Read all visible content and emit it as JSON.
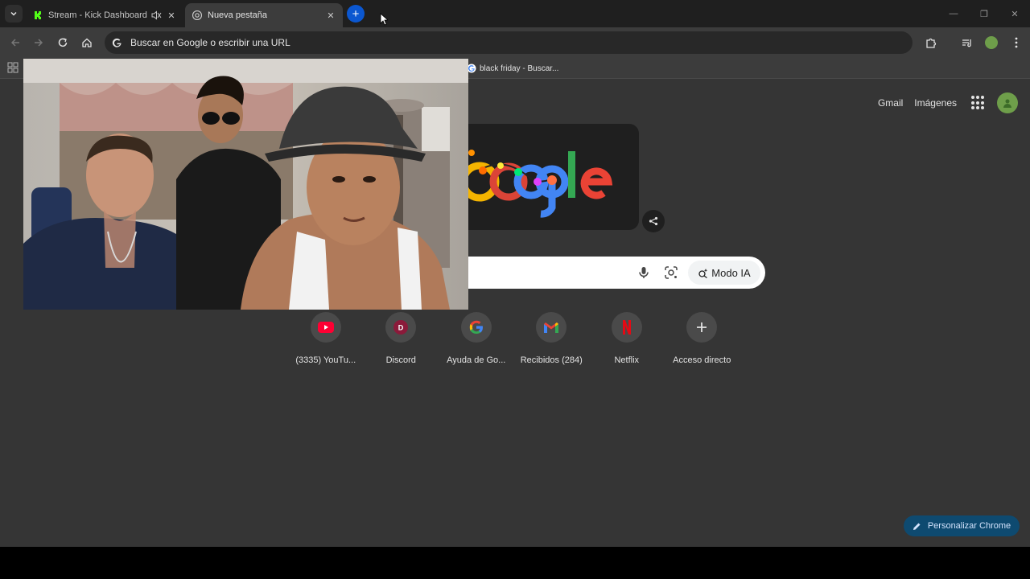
{
  "tabs": [
    {
      "title": "Stream - Kick Dashboard",
      "active": false,
      "muted": true
    },
    {
      "title": "Nueva pestaña",
      "active": true,
      "muted": false
    }
  ],
  "toolbar": {
    "omnibox_placeholder": "Buscar en Google o escribir una URL"
  },
  "bookmarks": [
    {
      "label": "black friday - Buscar..."
    }
  ],
  "header": {
    "gmail_label": "Gmail",
    "images_label": "Imágenes"
  },
  "search": {
    "ai_mode_label": "Modo IA"
  },
  "shortcuts": [
    {
      "label": "(3335) YouTu...",
      "icon": "youtube-icon"
    },
    {
      "label": "Discord",
      "icon": "discord-icon"
    },
    {
      "label": "Ayuda de Go...",
      "icon": "google-icon"
    },
    {
      "label": "Recibidos (284)",
      "icon": "gmail-icon"
    },
    {
      "label": "Netflix",
      "icon": "netflix-icon"
    },
    {
      "label": "Acceso directo",
      "icon": "plus-icon"
    }
  ],
  "customize": {
    "label": "Personalizar Chrome"
  },
  "colors": {
    "accent": "#0b57d0",
    "page_bg": "#353535",
    "toolbar_bg": "#3c3c3c",
    "tabstrip_bg": "#1f1f1f"
  }
}
